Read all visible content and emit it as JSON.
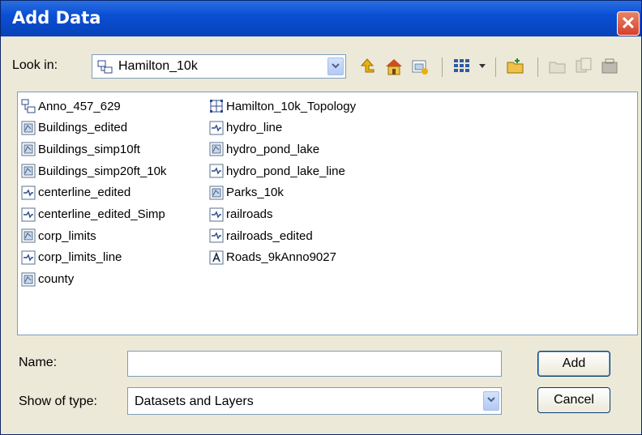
{
  "window": {
    "title": "Add Data"
  },
  "look_in": {
    "label": "Look in:",
    "value": "Hamilton_10k"
  },
  "files": [
    {
      "label": "Anno_457_629",
      "icon": "geodatabase-icon"
    },
    {
      "label": "Buildings_edited",
      "icon": "polygon-featureclass-icon"
    },
    {
      "label": "Buildings_simp10ft",
      "icon": "polygon-featureclass-icon"
    },
    {
      "label": "Buildings_simp20ft_10k",
      "icon": "polygon-featureclass-icon"
    },
    {
      "label": "centerline_edited",
      "icon": "line-featureclass-icon"
    },
    {
      "label": "centerline_edited_Simp",
      "icon": "line-featureclass-icon"
    },
    {
      "label": "corp_limits",
      "icon": "polygon-featureclass-icon"
    },
    {
      "label": "corp_limits_line",
      "icon": "line-featureclass-icon"
    },
    {
      "label": "county",
      "icon": "polygon-featureclass-icon"
    },
    {
      "label": "Hamilton_10k_Topology",
      "icon": "topology-icon"
    },
    {
      "label": "hydro_line",
      "icon": "line-featureclass-icon"
    },
    {
      "label": "hydro_pond_lake",
      "icon": "polygon-featureclass-icon"
    },
    {
      "label": "hydro_pond_lake_line",
      "icon": "line-featureclass-icon"
    },
    {
      "label": "Parks_10k",
      "icon": "polygon-featureclass-icon"
    },
    {
      "label": "railroads",
      "icon": "line-featureclass-icon"
    },
    {
      "label": "railroads_edited",
      "icon": "line-featureclass-icon"
    },
    {
      "label": "Roads_9kAnno9027",
      "icon": "annotation-icon"
    }
  ],
  "name": {
    "label": "Name:",
    "value": ""
  },
  "show_type": {
    "label": "Show of type:",
    "value": "Datasets and Layers"
  },
  "buttons": {
    "add": "Add",
    "cancel": "Cancel"
  }
}
